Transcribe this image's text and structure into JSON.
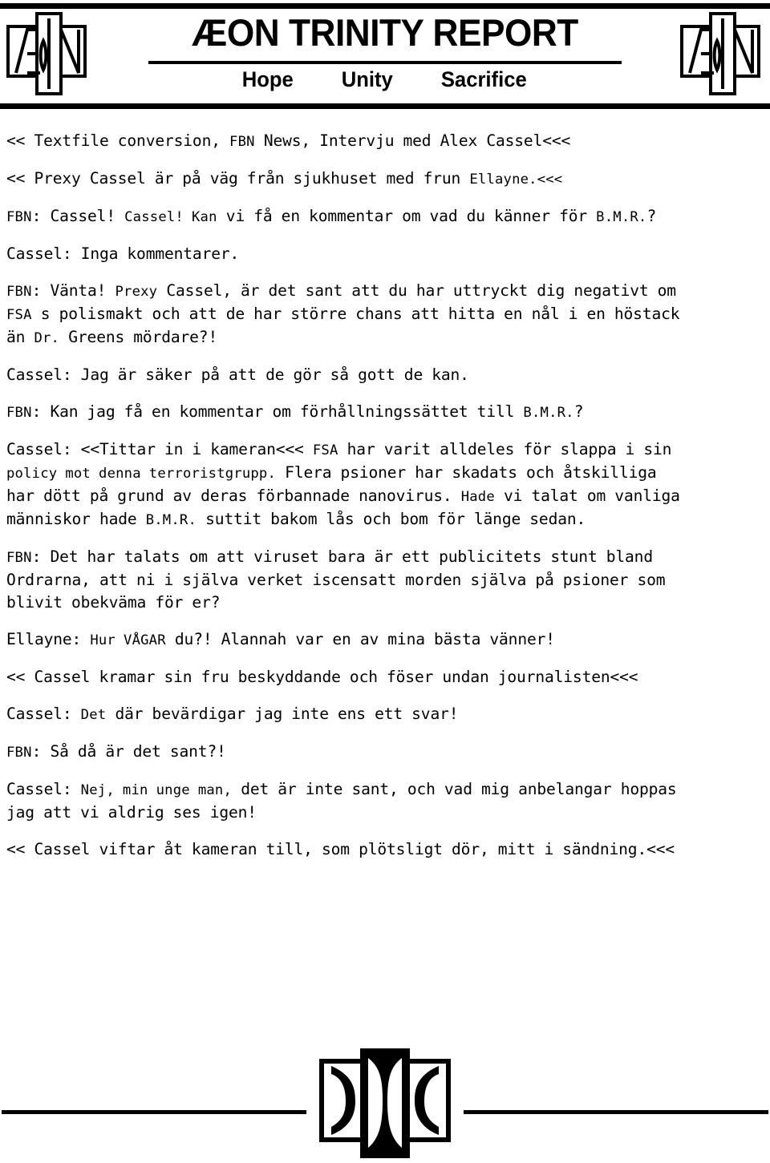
{
  "masthead": {
    "title": "ÆON TRINITY REPORT",
    "tagline": [
      "Hope",
      "Unity",
      "Sacrifice"
    ],
    "logo_left_name": "aeon-logo",
    "logo_right_name": "aeon-logo"
  },
  "transcript": {
    "paragraphs": [
      {
        "id": "p1",
        "runs": [
          {
            "text": "<< Textfile conversion, ",
            "style": "normal"
          },
          {
            "text": "FBN",
            "style": "smallcaps"
          },
          {
            "text": " News, Intervju med Alex Cassel<<<",
            "style": "normal"
          }
        ]
      },
      {
        "id": "p2",
        "runs": [
          {
            "text": "<< Prexy Cassel är på väg från sjukhuset med frun ",
            "style": "normal"
          },
          {
            "text": "Ellayne.<<<",
            "style": "smallcaps"
          }
        ]
      },
      {
        "id": "p3",
        "runs": [
          {
            "text": "FBN",
            "style": "smallcaps"
          },
          {
            "text": ": Cassel! ",
            "style": "normal"
          },
          {
            "text": "Cassel! Kan",
            "style": "smallcaps"
          },
          {
            "text": " vi få en kommentar om vad du känner för ",
            "style": "normal"
          },
          {
            "text": "B.M.R.",
            "style": "smallcaps"
          },
          {
            "text": "?",
            "style": "normal"
          }
        ]
      },
      {
        "id": "p4",
        "runs": [
          {
            "text": "Cassel: Inga kommentarer.",
            "style": "normal"
          }
        ]
      },
      {
        "id": "p5",
        "runs": [
          {
            "text": "FBN",
            "style": "smallcaps"
          },
          {
            "text": ": Vänta! ",
            "style": "normal"
          },
          {
            "text": "Prexy",
            "style": "smallcaps"
          },
          {
            "text": " Cassel, är det sant att du har uttryckt dig negativt om\n",
            "style": "normal"
          },
          {
            "text": "FSA",
            "style": "smallcaps"
          },
          {
            "text": " s polismakt och att de har större chans att hitta en nål i en höstack\nän ",
            "style": "normal"
          },
          {
            "text": "Dr.",
            "style": "smallcaps"
          },
          {
            "text": " Greens mördare?!",
            "style": "normal"
          }
        ]
      },
      {
        "id": "p6",
        "runs": [
          {
            "text": "Cassel: Jag är säker på att de gör så gott de kan.",
            "style": "normal"
          }
        ]
      },
      {
        "id": "p7",
        "runs": [
          {
            "text": "FBN",
            "style": "smallcaps"
          },
          {
            "text": ": Kan jag få en kommentar om förhållningssättet till ",
            "style": "normal"
          },
          {
            "text": "B.M.R.",
            "style": "smallcaps"
          },
          {
            "text": "?",
            "style": "normal"
          }
        ]
      },
      {
        "id": "p8",
        "runs": [
          {
            "text": "Cassel: <<Tittar in i kameran<<< ",
            "style": "normal"
          },
          {
            "text": "FSA",
            "style": "smallcaps"
          },
          {
            "text": " har varit alldeles för slappa i sin\n",
            "style": "normal"
          },
          {
            "text": "policy mot denna terroristgrupp.",
            "style": "smallcaps"
          },
          {
            "text": " Flera psioner har skadats och åtskilliga\nhar dött på grund av deras förbannade nanovirus. ",
            "style": "normal"
          },
          {
            "text": "Hade",
            "style": "smallcaps"
          },
          {
            "text": " vi talat om vanliga\nmänniskor hade ",
            "style": "normal"
          },
          {
            "text": "B.M.R.",
            "style": "smallcaps"
          },
          {
            "text": " suttit bakom lås och bom för länge sedan.",
            "style": "normal"
          }
        ]
      },
      {
        "id": "p9",
        "runs": [
          {
            "text": "FBN",
            "style": "smallcaps"
          },
          {
            "text": ": Det har talats om att viruset bara är ett publicitets stunt bland\nOrdrarna, att ni i själva verket iscensatt morden själva på psioner som\nblivit obekväma för er?",
            "style": "normal"
          }
        ]
      },
      {
        "id": "p10",
        "runs": [
          {
            "text": "Ellayne: ",
            "style": "normal"
          },
          {
            "text": "Hur VÅGAR",
            "style": "smallcaps"
          },
          {
            "text": " du?! Alannah var en av mina bästa vänner!",
            "style": "normal"
          }
        ]
      },
      {
        "id": "p11",
        "runs": [
          {
            "text": "<< Cassel kramar sin fru beskyddande och föser undan journalisten<<<",
            "style": "normal"
          }
        ]
      },
      {
        "id": "p12",
        "runs": [
          {
            "text": "Cassel: ",
            "style": "normal"
          },
          {
            "text": "Det",
            "style": "smallcaps"
          },
          {
            "text": " där bevärdigar jag inte ens ett svar!",
            "style": "normal"
          }
        ]
      },
      {
        "id": "p13",
        "runs": [
          {
            "text": "FBN",
            "style": "smallcaps"
          },
          {
            "text": ": Så då är det sant?!",
            "style": "normal"
          }
        ]
      },
      {
        "id": "p14",
        "runs": [
          {
            "text": "Cassel: ",
            "style": "normal"
          },
          {
            "text": "Nej, min unge man,",
            "style": "smallcaps"
          },
          {
            "text": " det är inte sant, och vad mig anbelangar hoppas\njag att vi aldrig ses igen!",
            "style": "normal"
          }
        ]
      },
      {
        "id": "p15",
        "runs": [
          {
            "text": "<< Cassel viftar åt kameran till, som plötsligt dör, mitt i sändning.<<<",
            "style": "normal"
          }
        ]
      }
    ]
  },
  "footer": {
    "mark_name": "trinity-symbol"
  },
  "colors": {
    "ink": "#000000",
    "page": "#ffffff"
  }
}
